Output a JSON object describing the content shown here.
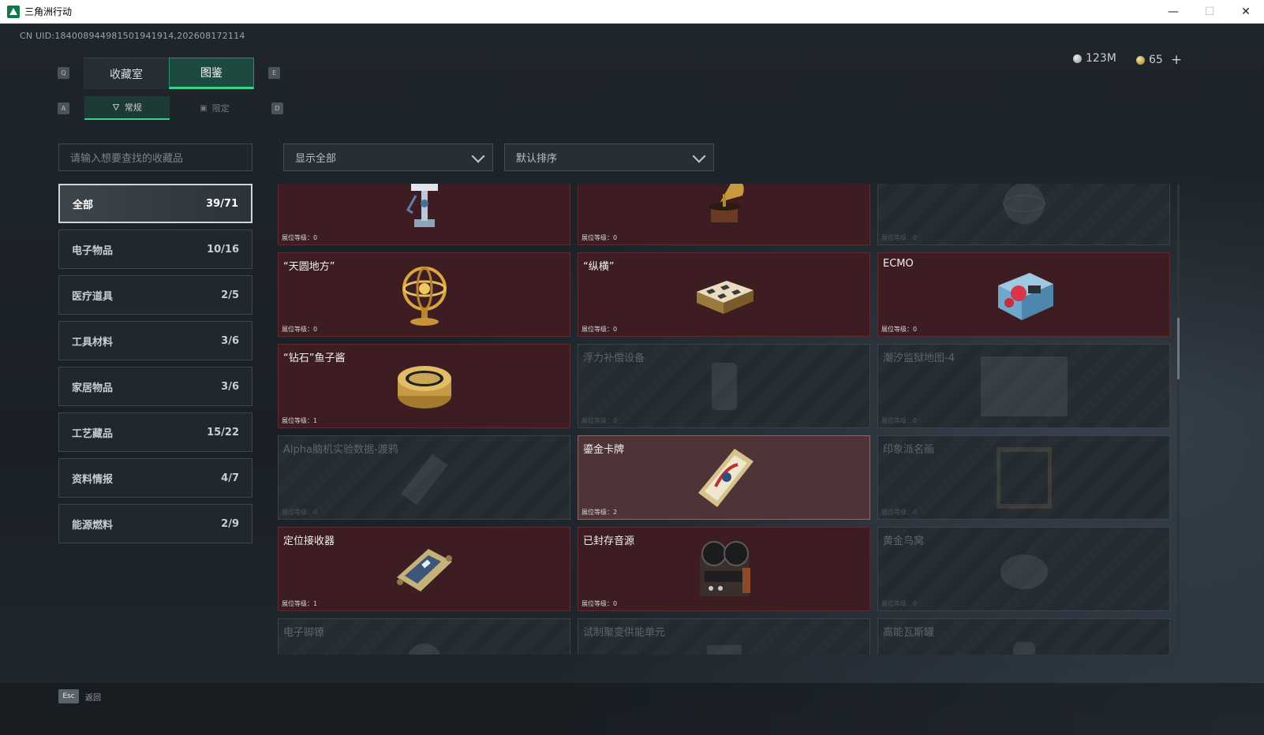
{
  "window": {
    "title": "三角洲行动",
    "minimize": "—",
    "maximize": "☐",
    "close": "✕"
  },
  "header": {
    "uid": "CN UID:18400894498150194191​4,202608172114",
    "currency_silver": "123M",
    "currency_gold": "65",
    "add": "+"
  },
  "tabs": {
    "key_left": "Q",
    "key_right": "E",
    "items": [
      {
        "label": "收藏室",
        "active": false
      },
      {
        "label": "图鉴",
        "active": true
      }
    ]
  },
  "subtabs": {
    "key_left": "A",
    "key_right": "D",
    "items": [
      {
        "label": "常规",
        "active": true
      },
      {
        "label": "限定",
        "active": false
      }
    ]
  },
  "search": {
    "placeholder": "请输入想要查找的收藏品"
  },
  "filters": {
    "display": "显示全部",
    "sort": "默认排序"
  },
  "categories": [
    {
      "label": "全部",
      "count": "39/71",
      "active": true
    },
    {
      "label": "电子物品",
      "count": "10/16",
      "active": false
    },
    {
      "label": "医疗道具",
      "count": "2/5",
      "active": false
    },
    {
      "label": "工具材料",
      "count": "3/6",
      "active": false
    },
    {
      "label": "家居物品",
      "count": "3/6",
      "active": false
    },
    {
      "label": "工艺藏品",
      "count": "15/22",
      "active": false
    },
    {
      "label": "资料情报",
      "count": "4/7",
      "active": false
    },
    {
      "label": "能源燃料",
      "count": "2/9",
      "active": false
    }
  ],
  "cards": [
    {
      "name": "",
      "level": "展位等级：0",
      "state": "owned",
      "icon": "robot-arm-icon"
    },
    {
      "name": "",
      "level": "展位等级：0",
      "state": "owned",
      "icon": "gramophone-icon"
    },
    {
      "name": "",
      "level": "展位等级：0",
      "state": "locked",
      "icon": "globe-icon"
    },
    {
      "name": "“天圆地方”",
      "level": "展位等级：0",
      "state": "owned",
      "icon": "armillary-sphere-icon"
    },
    {
      "name": "“纵横”",
      "level": "展位等级：0",
      "state": "owned",
      "icon": "chess-box-icon"
    },
    {
      "name": "ECMO",
      "level": "展位等级：0",
      "state": "owned",
      "icon": "ecmo-machine-icon"
    },
    {
      "name": "“钻石”鱼子酱",
      "level": "展位等级：1",
      "state": "owned",
      "icon": "caviar-tin-icon"
    },
    {
      "name": "浮力补偿设备",
      "level": "展位等级：0",
      "state": "locked",
      "icon": "buoyancy-device-icon"
    },
    {
      "name": "潮汐监狱地图-4",
      "level": "展位等级：0",
      "state": "locked",
      "icon": "map-icon"
    },
    {
      "name": "Alpha脑机实验数据-渡鸦",
      "level": "展位等级：0",
      "state": "locked",
      "icon": "data-drive-icon"
    },
    {
      "name": "鎏金卡牌",
      "level": "展位等级：2",
      "state": "highlight",
      "icon": "gilded-card-icon"
    },
    {
      "name": "印象派名画",
      "level": "展位等级：0",
      "state": "locked",
      "icon": "painting-icon"
    },
    {
      "name": "定位接收器",
      "level": "展位等级：1",
      "state": "owned",
      "icon": "receiver-icon"
    },
    {
      "name": "已封存音源",
      "level": "展位等级：0",
      "state": "owned",
      "icon": "tape-recorder-icon"
    },
    {
      "name": "黄金鸟窝",
      "level": "展位等级：0",
      "state": "locked",
      "icon": "golden-nest-icon"
    },
    {
      "name": "电子脚镣",
      "level": "",
      "state": "locked",
      "icon": "ankle-monitor-icon"
    },
    {
      "name": "试制聚变供能单元",
      "level": "",
      "state": "locked",
      "icon": "fusion-unit-icon"
    },
    {
      "name": "高能瓦斯罐",
      "level": "",
      "state": "locked",
      "icon": "gas-canister-icon"
    }
  ],
  "footer": {
    "esc_key": "Esc",
    "back": "返回"
  },
  "colors": {
    "accent_green": "#3bd18f",
    "owned_card": "#3d1d22",
    "highlight_card": "#4e3337",
    "background": "#1b2127"
  }
}
